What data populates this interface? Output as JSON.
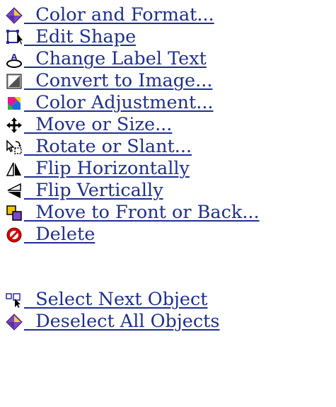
{
  "menu": {
    "items": [
      {
        "label": "  Color and Format...",
        "icon": "diamond-icon"
      },
      {
        "label": "  Edit Shape",
        "icon": "edit-shape-icon"
      },
      {
        "label": "  Change Label Text",
        "icon": "label-text-icon"
      },
      {
        "label": "  Convert to Image...",
        "icon": "image-icon"
      },
      {
        "label": "  Color Adjustment...",
        "icon": "color-adjust-icon"
      },
      {
        "label": "  Move or Size...",
        "icon": "move-icon"
      },
      {
        "label": "  Rotate or Slant...",
        "icon": "rotate-icon"
      },
      {
        "label": "  Flip Horizontally",
        "icon": "flip-horizontal-icon"
      },
      {
        "label": "  Flip Vertically",
        "icon": "flip-vertical-icon"
      },
      {
        "label": "  Move to Front or Back...",
        "icon": "front-back-icon"
      },
      {
        "label": "  Delete",
        "icon": "delete-icon"
      }
    ],
    "secondary": [
      {
        "label": "  Select Next Object",
        "icon": "select-next-icon"
      },
      {
        "label": "  Deselect All Objects",
        "icon": "diamond-icon"
      }
    ]
  },
  "colors": {
    "link": "#1f2f8f",
    "accent_purple": "#6b3fb3",
    "accent_yellow": "#f2c400",
    "delete_red": "#d40000"
  }
}
